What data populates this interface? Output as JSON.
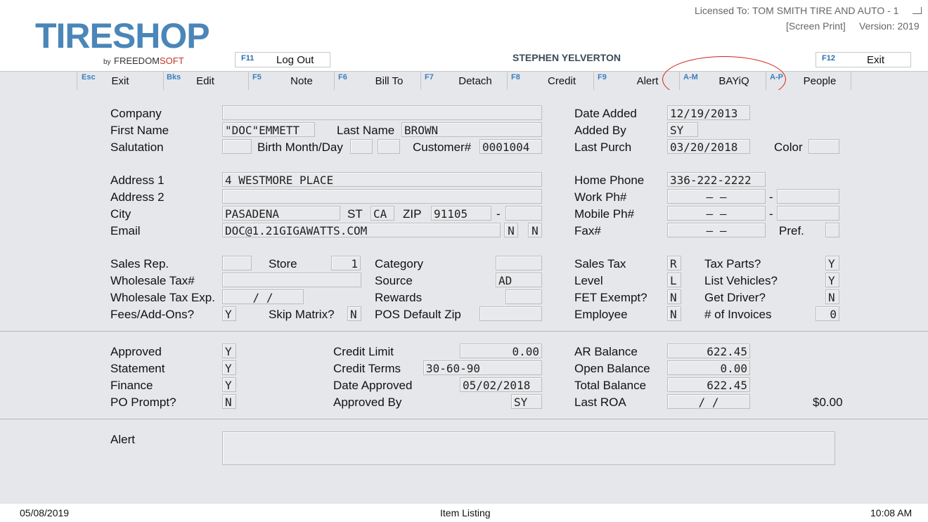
{
  "app": {
    "logo_main1": "TIRE",
    "logo_main2": "SHOP",
    "logo_by": "by",
    "logo_freedom": "FREEDOM",
    "logo_soft": "SOFT",
    "licensed": "Licensed To: TOM SMITH TIRE AND AUTO - 1",
    "screen_print": "[Screen Print]",
    "version": "Version: 2019",
    "user": "STEPHEN YELVERTON"
  },
  "top_keys": {
    "f11_key": "F11",
    "f11_label": "Log Out",
    "f12_key": "F12",
    "f12_label": "Exit"
  },
  "toolbar": [
    {
      "key": "Esc",
      "label": "Exit"
    },
    {
      "key": "Bks",
      "label": "Edit"
    },
    {
      "key": "F5",
      "label": "Note"
    },
    {
      "key": "F6",
      "label": "Bill To"
    },
    {
      "key": "F7",
      "label": "Detach"
    },
    {
      "key": "F8",
      "label": "Credit"
    },
    {
      "key": "F9",
      "label": "Alert"
    },
    {
      "key": "A-M",
      "label": "BAYiQ"
    },
    {
      "key": "A-P",
      "label": "People"
    }
  ],
  "labels": {
    "company": "Company",
    "first_name": "First Name",
    "last_name": "Last Name",
    "salutation": "Salutation",
    "birth": "Birth Month/Day",
    "customer": "Customer#",
    "date_added": "Date Added",
    "added_by": "Added By",
    "last_purch": "Last Purch",
    "color": "Color",
    "address1": "Address 1",
    "address2": "Address 2",
    "city": "City",
    "st": "ST",
    "zip": "ZIP",
    "email": "Email",
    "home_phone": "Home Phone",
    "work_ph": "Work Ph#",
    "mobile_ph": "Mobile Ph#",
    "fax": "Fax#",
    "pref": "Pref.",
    "sales_rep": "Sales Rep.",
    "store": "Store",
    "category": "Category",
    "wholesale_tax": "Wholesale Tax#",
    "source": "Source",
    "wholesale_exp": "Wholesale Tax Exp.",
    "rewards": "Rewards",
    "fees": "Fees/Add-Ons?",
    "skip_matrix": "Skip Matrix?",
    "pos_zip": "POS Default Zip",
    "sales_tax": "Sales Tax",
    "tax_parts": "Tax Parts?",
    "level": "Level",
    "list_vehicles": "List Vehicles?",
    "fet_exempt": "FET Exempt?",
    "get_driver": "Get Driver?",
    "employee": "Employee",
    "num_invoices": "# of Invoices",
    "approved": "Approved",
    "statement": "Statement",
    "finance": "Finance",
    "po_prompt": "PO Prompt?",
    "credit_limit": "Credit Limit",
    "credit_terms": "Credit Terms",
    "date_approved": "Date Approved",
    "approved_by": "Approved By",
    "ar_balance": "AR Balance",
    "open_balance": "Open Balance",
    "total_balance": "Total Balance",
    "last_roa": "Last ROA",
    "alert": "Alert"
  },
  "values": {
    "company": "",
    "first_name": "\"DOC\"EMMETT",
    "last_name": "BROWN",
    "salutation": "",
    "birth_month": "",
    "birth_day": "",
    "customer": "0001004",
    "date_added": "12/19/2013",
    "added_by": "SY",
    "last_purch": "03/20/2018",
    "color": "",
    "address1": "4 WESTMORE PLACE",
    "address2": "",
    "city": "PASADENA",
    "st": "CA",
    "zip": "91105",
    "zip_ext": "",
    "email": "DOC@1.21GIGAWATTS.COM",
    "email_flag1": "N",
    "email_flag2": "N",
    "home_phone": "336-222-2222",
    "work_ph": "–    –",
    "work_ext": "",
    "mobile_ph": "–    –",
    "mobile_ext": "",
    "fax": "–    –",
    "pref": "",
    "sales_rep": "",
    "store": "1",
    "category": "",
    "wholesale_tax": "",
    "source": "AD",
    "wholesale_exp": "/   /",
    "rewards": "",
    "fees": "Y",
    "skip_matrix": "N",
    "pos_zip": "",
    "sales_tax": "R",
    "tax_parts": "Y",
    "level": "L",
    "list_vehicles": "Y",
    "fet_exempt": "N",
    "get_driver": "N",
    "employee": "N",
    "num_invoices": "0",
    "approved": "Y",
    "statement": "Y",
    "finance": "Y",
    "po_prompt": "N",
    "credit_limit": "0.00",
    "credit_terms": "30-60-90",
    "date_approved": "05/02/2018",
    "approved_by": "SY",
    "ar_balance": "622.45",
    "open_balance": "0.00",
    "total_balance": "622.45",
    "last_roa": "/   /",
    "roa_amount": "$0.00",
    "alert": ""
  },
  "status": {
    "date": "05/08/2019",
    "center": "Item Listing",
    "time": "10:08 AM"
  },
  "colors": {
    "accent": "#4a86b8",
    "highlight": "#d21e1e",
    "panel": "#e6e7ea"
  }
}
